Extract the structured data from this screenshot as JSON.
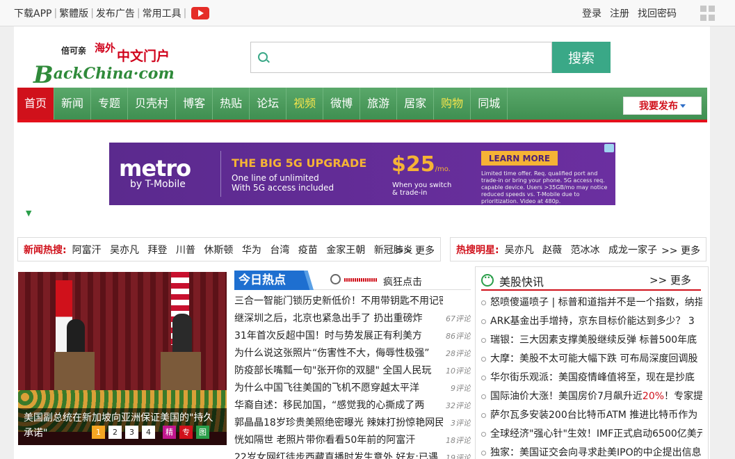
{
  "topbar": {
    "links": [
      "下载APP",
      "繁體版",
      "发布广告",
      "常用工具"
    ],
    "right": [
      "登录",
      "注册",
      "找回密码"
    ]
  },
  "logo": {
    "small": "倍可亲",
    "red1": "海外",
    "red2": "中文门户",
    "en_b": "B",
    "en_rest": "ackChina·com"
  },
  "search": {
    "placeholder": "",
    "button": "搜索"
  },
  "nav": {
    "items": [
      {
        "label": "首页"
      },
      {
        "label": "新闻"
      },
      {
        "label": "专题"
      },
      {
        "label": "贝壳村"
      },
      {
        "label": "博客"
      },
      {
        "label": "热贴"
      },
      {
        "label": "论坛"
      },
      {
        "label": "视频"
      },
      {
        "label": "微博"
      },
      {
        "label": "旅游"
      },
      {
        "label": "居家"
      },
      {
        "label": "购物"
      },
      {
        "label": "同城"
      }
    ],
    "publish": "我要发布"
  },
  "ad": {
    "brand": "metro",
    "brand_sub": "by T-Mobile",
    "headline": "THE BIG 5G UPGRADE",
    "line1": "One line of unlimited",
    "line2": "With 5G access included",
    "price": "$25",
    "price_unit": "/mo.",
    "switch1": "When you switch",
    "switch2": "& trade-in",
    "cta": "LEARN MORE",
    "fine": "Limited time offer. Req. qualified port and trade-in or bring your phone. 5G access req. capable device. Users >35GB/mo may notice reduced speeds vs. T-Mobile due to prioritization. Video at 480p."
  },
  "hot_news": {
    "label": "新闻热搜:",
    "tags": [
      "阿富汗",
      "吴亦凡",
      "拜登",
      "川普",
      "休斯顿",
      "华为",
      "台湾",
      "疫苗",
      "金家王朝",
      "新冠肺炎"
    ],
    "more": ">> 更多"
  },
  "hot_stars": {
    "label": "热搜明星:",
    "tags": [
      "吴亦凡",
      "赵薇",
      "范冰冰",
      "成龙一家子"
    ],
    "more": ">> 更多"
  },
  "feature": {
    "caption": "美国副总统在新加坡向亚洲保证美国的\"持久承诺\"",
    "pages": [
      "1",
      "2",
      "3",
      "4"
    ],
    "tags": [
      "精",
      "专",
      "图"
    ]
  },
  "today": {
    "title": "今日热点",
    "crazy": "疯狂点击",
    "items": [
      {
        "t": "三合一智能门锁历史新低价！不用带钥匙不用记密码",
        "c": ""
      },
      {
        "t": "继深圳之后，北京也紧急出手了 扔出重磅炸",
        "c": "67评论"
      },
      {
        "t": "31年首次反超中国！时与势发展正有利美方",
        "c": "86评论"
      },
      {
        "t": "为什么说这张照片“伤害性不大，侮辱性极强”",
        "c": "28评论"
      },
      {
        "t": "防疫部长嘴瓢一句\"张开你的双腿\" 全国人民玩",
        "c": "10评论"
      },
      {
        "t": "为什么中国飞往美国的飞机不愿穿越太平洋",
        "c": "9评论"
      },
      {
        "t": "华裔自述：移民加国，“感觉我的心撕成了两",
        "c": "32评论"
      },
      {
        "t": "郭晶晶18岁珍贵美照绝密曝光 辣妹打扮惊艳网民",
        "c": "3评论"
      },
      {
        "t": "恍如隔世 老照片带你看看50年前的阿富汗",
        "c": "18评论"
      },
      {
        "t": "22岁女网红徒步西藏直播时发生意外 好友:已遇",
        "c": "19评论"
      }
    ]
  },
  "stock": {
    "title": "美股快讯",
    "more": ">> 更多",
    "items": [
      {
        "pre": "怒喷傻逼喷子 | 标普和道指并不是一个指数，纳指",
        "hl": "",
        "post": ""
      },
      {
        "pre": "ARK基金出手增持，京东目标价能达到多少？ 3",
        "hl": "",
        "post": ""
      },
      {
        "pre": "瑞银：三大因素支撑美股继续反弹 标普500年底",
        "hl": "",
        "post": ""
      },
      {
        "pre": "大摩：美股不太可能大幅下跌 可布局深度回调股",
        "hl": "",
        "post": ""
      },
      {
        "pre": "华尔街乐观派：美国疫情峰值将至，现在是抄底",
        "hl": "",
        "post": ""
      },
      {
        "pre": "国际油价大涨！美国房价7月飙升近",
        "hl": "20%",
        "post": "！专家提"
      },
      {
        "pre": "萨尔瓦多安装200台比特币ATM 推进比特币作为",
        "hl": "",
        "post": ""
      },
      {
        "pre": "全球经济\"强心针\"生效！IMF正式启动6500亿美元",
        "hl": "",
        "post": ""
      },
      {
        "pre": "独家：美国证交会向寻求赴美IPO的中企提出信息",
        "hl": "",
        "post": ""
      }
    ]
  }
}
